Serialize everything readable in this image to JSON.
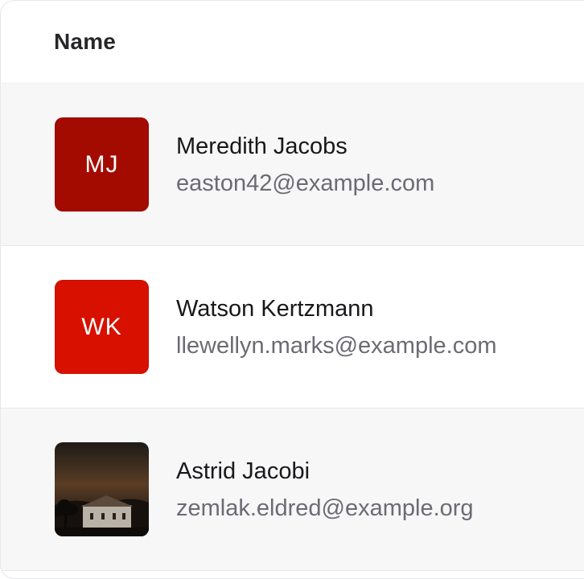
{
  "table": {
    "header": {
      "name_label": "Name"
    },
    "rows": [
      {
        "name": "Meredith Jacobs",
        "email": "easton42@example.com",
        "initials": "MJ",
        "avatar_color": "#a40b00"
      },
      {
        "name": "Watson Kertzmann",
        "email": "llewellyn.marks@example.com",
        "initials": "WK",
        "avatar_color": "#d71000"
      },
      {
        "name": "Astrid Jacobi",
        "email": "zemlak.eldred@example.org",
        "avatar_icon": "photo-avatar"
      }
    ]
  }
}
